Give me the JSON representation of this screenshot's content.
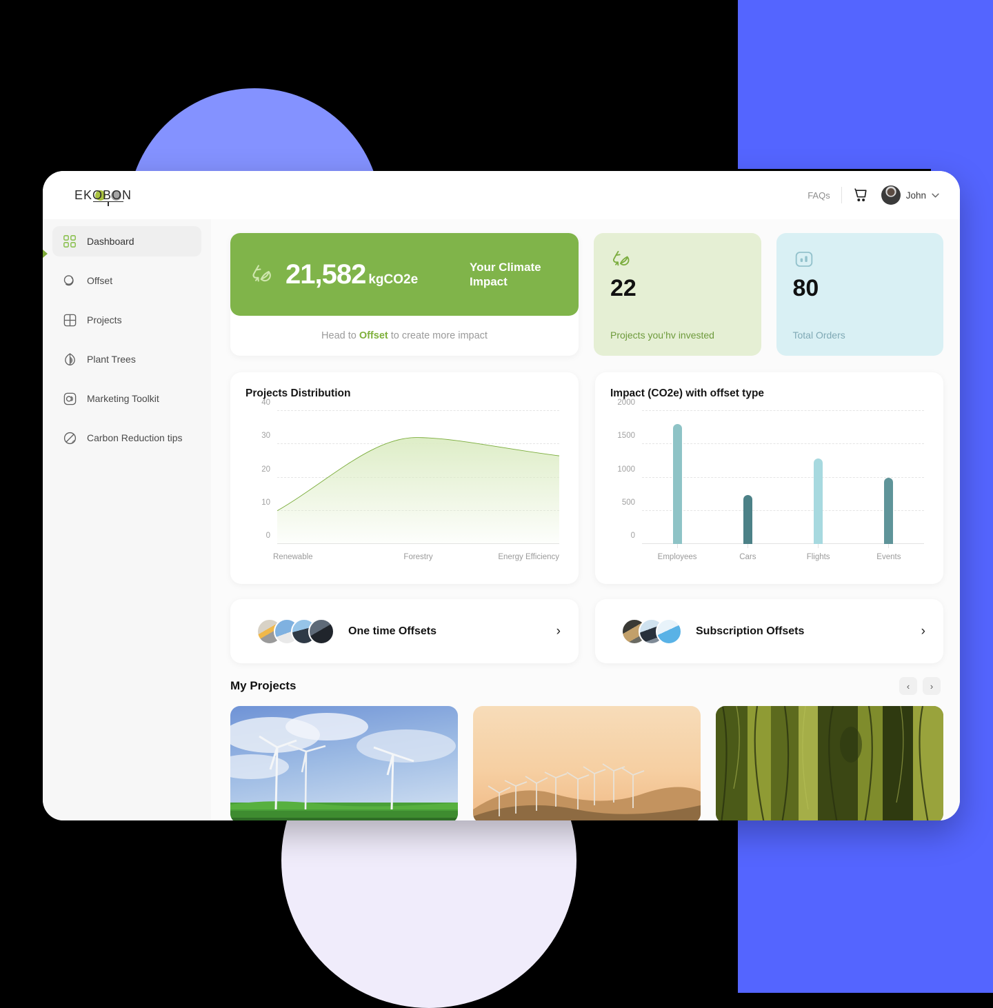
{
  "brand": {
    "name": "EKOBON",
    "accent_green": "#80b44a",
    "accent_blue": "#5465ff"
  },
  "topbar": {
    "faqs_label": "FAQs",
    "cart_icon": "shopping-cart-icon",
    "user_name": "John",
    "chevron": "∨"
  },
  "sidebar": {
    "items": [
      {
        "label": "Dashboard",
        "icon": "grid-dashboard-icon",
        "active": true
      },
      {
        "label": "Offset",
        "icon": "offset-circles-icon",
        "active": false
      },
      {
        "label": "Projects",
        "icon": "projects-grid-icon",
        "active": false
      },
      {
        "label": "Plant Trees",
        "icon": "leaf-icon",
        "active": false
      },
      {
        "label": "Marketing Toolkit",
        "icon": "marketing-rings-icon",
        "active": false
      },
      {
        "label": "Carbon Reduction tips",
        "icon": "carbon-reduction-icon",
        "active": false
      }
    ]
  },
  "stats": {
    "climate": {
      "icon": "recycle-leaf-icon",
      "value": "21,582",
      "unit": "kgCO2e",
      "caption": "Your Climate Impact",
      "footer_prefix": "Head to",
      "footer_link": "Offset",
      "footer_suffix": "to create more impact"
    },
    "invested": {
      "icon": "recycle-leaf-icon",
      "value": "22",
      "label": "Projects you’hv invested"
    },
    "orders": {
      "icon": "orders-bars-icon",
      "value": "80",
      "label": "Total Orders"
    }
  },
  "chart_data": [
    {
      "type": "area",
      "title": "Projects Distribution",
      "categories": [
        "Renewable",
        "Forestry",
        "Energy Efficiency"
      ],
      "values": [
        10,
        32,
        26.5
      ],
      "xlabel": "",
      "ylabel": "",
      "ylim": [
        0,
        40
      ],
      "yticks": [
        0,
        10,
        20,
        30,
        40
      ],
      "grid": true,
      "legend": "none",
      "line_color": "#7aac3a",
      "fill_color": "#dcecc4"
    },
    {
      "type": "bar",
      "title": "Impact (CO2e) with offset type",
      "categories": [
        "Employees",
        "Cars",
        "Flights",
        "Events"
      ],
      "values": [
        1800,
        740,
        1290,
        1000
      ],
      "bar_colors": [
        "#8ec3c6",
        "#4c8187",
        "#a7d9df",
        "#5f9499"
      ],
      "xlabel": "",
      "ylabel": "",
      "ylim": [
        0,
        2000
      ],
      "yticks": [
        0,
        500,
        1000,
        1500,
        2000
      ],
      "grid": true,
      "legend": "none"
    }
  ],
  "offsets": [
    {
      "label": "One time Offsets",
      "arrow": "›",
      "thumbs": 4
    },
    {
      "label": "Subscription Offsets",
      "arrow": "›",
      "thumbs": 3
    }
  ],
  "my_projects": {
    "title": "My Projects",
    "prev": "‹",
    "next": "›",
    "cards": [
      {
        "name": "wind-turbines-green-field"
      },
      {
        "name": "wind-farm-sunset-hills"
      },
      {
        "name": "mossy-forest-trees"
      }
    ]
  }
}
